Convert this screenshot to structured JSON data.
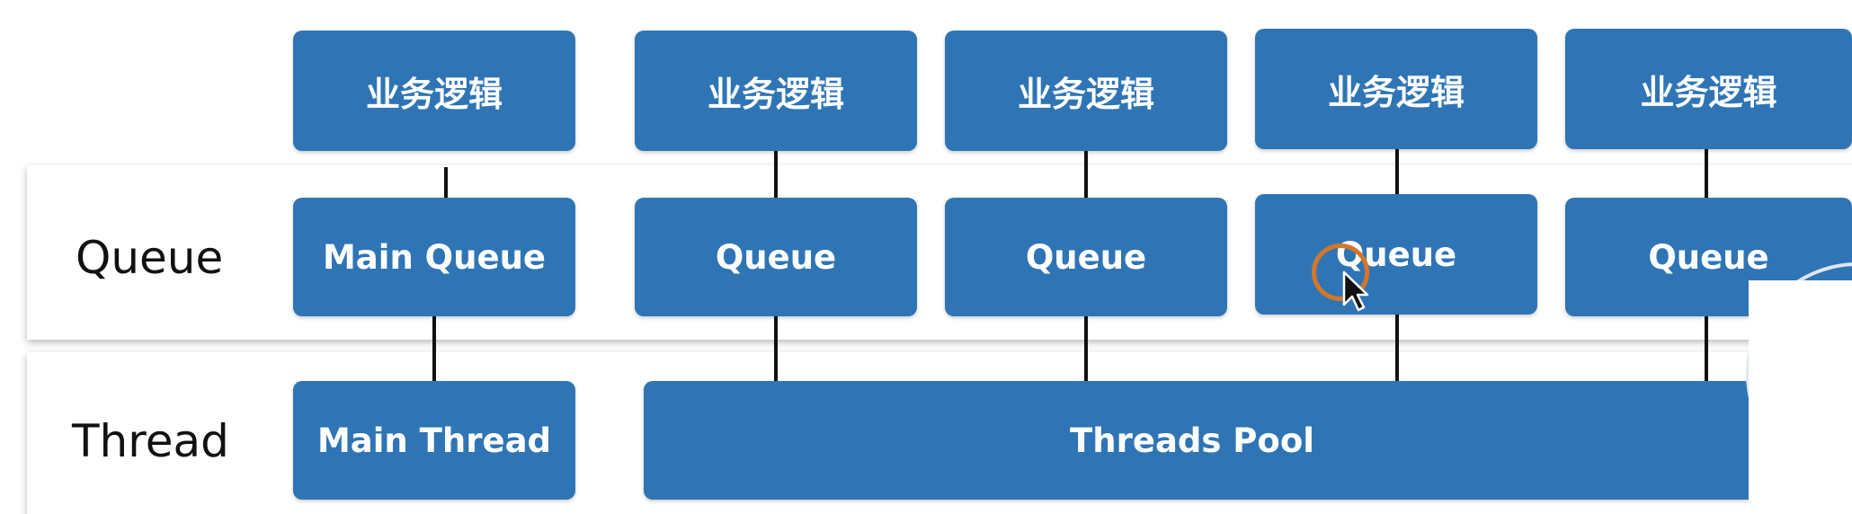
{
  "rows": {
    "queue_label": "Queue",
    "thread_label": "Thread"
  },
  "business_logic": [
    "业务逻辑",
    "业务逻辑",
    "业务逻辑",
    "业务逻辑",
    "业务逻辑"
  ],
  "queues": [
    "Main Queue",
    "Queue",
    "Queue",
    "Queue",
    "Queue"
  ],
  "threads": {
    "main": "Main Thread",
    "pool": "Threads Pool"
  },
  "colors": {
    "box_fill": "#2f75b5",
    "box_text": "#ffffff",
    "connector": "#111111",
    "cursor_ring": "#d5762a"
  }
}
